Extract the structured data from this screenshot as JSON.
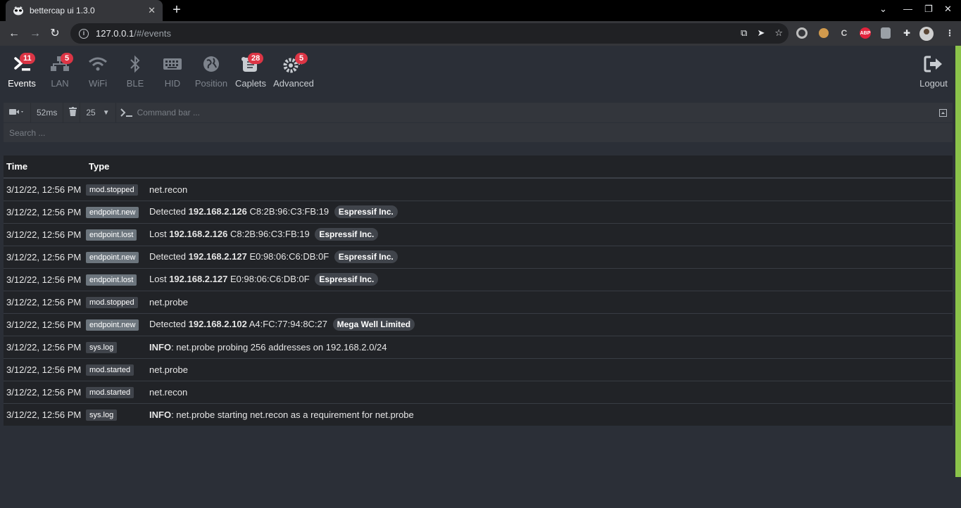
{
  "browser": {
    "tab_title": "bettercap ui 1.3.0",
    "url_host": "127.0.0.1",
    "url_path": "/#/events"
  },
  "nav": {
    "items": [
      {
        "label": "Events",
        "badge": "11"
      },
      {
        "label": "LAN",
        "badge": "5"
      },
      {
        "label": "WiFi",
        "badge": ""
      },
      {
        "label": "BLE",
        "badge": ""
      },
      {
        "label": "HID",
        "badge": ""
      },
      {
        "label": "Position",
        "badge": ""
      },
      {
        "label": "Caplets",
        "badge": "28"
      },
      {
        "label": "Advanced",
        "badge": "5"
      }
    ],
    "logout": "Logout"
  },
  "cmdbar": {
    "delay": "52ms",
    "limit": "25",
    "placeholder": "Command bar ..."
  },
  "search": {
    "placeholder": "Search ..."
  },
  "table": {
    "headers": [
      "Time",
      "Type"
    ],
    "rows": [
      {
        "time": "3/12/22, 12:56 PM",
        "type": "mod.stopped",
        "text": "net.recon"
      },
      {
        "time": "3/12/22, 12:56 PM",
        "type": "endpoint.new",
        "prefix": "Detected",
        "ip": "192.168.2.126",
        "mac": "C8:2B:96:C3:FB:19",
        "vendor": "Espressif Inc."
      },
      {
        "time": "3/12/22, 12:56 PM",
        "type": "endpoint.lost",
        "prefix": "Lost",
        "ip": "192.168.2.126",
        "mac": "C8:2B:96:C3:FB:19",
        "vendor": "Espressif Inc."
      },
      {
        "time": "3/12/22, 12:56 PM",
        "type": "endpoint.new",
        "prefix": "Detected",
        "ip": "192.168.2.127",
        "mac": "E0:98:06:C6:DB:0F",
        "vendor": "Espressif Inc."
      },
      {
        "time": "3/12/22, 12:56 PM",
        "type": "endpoint.lost",
        "prefix": "Lost",
        "ip": "192.168.2.127",
        "mac": "E0:98:06:C6:DB:0F",
        "vendor": "Espressif Inc."
      },
      {
        "time": "3/12/22, 12:56 PM",
        "type": "mod.stopped",
        "text": "net.probe"
      },
      {
        "time": "3/12/22, 12:56 PM",
        "type": "endpoint.new",
        "prefix": "Detected",
        "ip": "192.168.2.102",
        "mac": "A4:FC:77:94:8C:27",
        "vendor": "Mega Well Limited"
      },
      {
        "time": "3/12/22, 12:56 PM",
        "type": "sys.log",
        "level": "INFO",
        "text": ": net.probe probing 256 addresses on 192.168.2.0/24"
      },
      {
        "time": "3/12/22, 12:56 PM",
        "type": "mod.started",
        "text": "net.probe"
      },
      {
        "time": "3/12/22, 12:56 PM",
        "type": "mod.started",
        "text": "net.recon"
      },
      {
        "time": "3/12/22, 12:56 PM",
        "type": "sys.log",
        "level": "INFO",
        "text": ": net.probe starting net.recon as a requirement for net.probe"
      }
    ]
  },
  "colors": {
    "accent_badge": "#dc3545",
    "scrollbar": "#8bc34a",
    "background": "#2b2f37"
  }
}
